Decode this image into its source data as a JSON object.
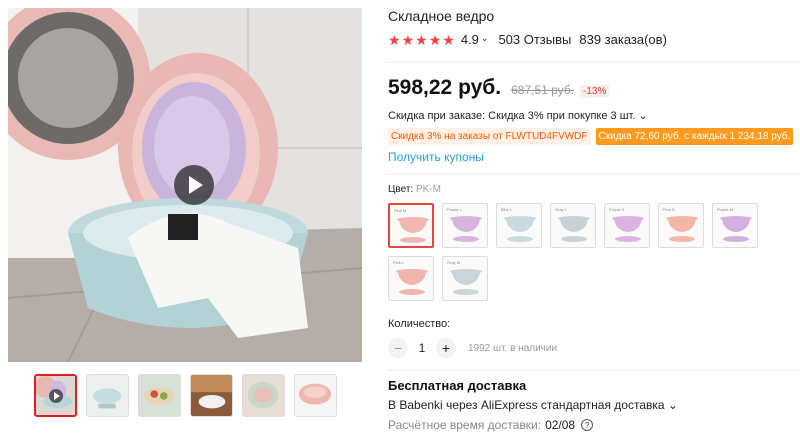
{
  "product": {
    "title": "Складное ведро",
    "rating": "4.9",
    "reviews": "503 Отзывы",
    "orders": "839 заказа(ов)"
  },
  "price": {
    "current": "598,22 руб.",
    "old": "687,51 руб.",
    "discount": "-13%"
  },
  "promo": {
    "order_discount": "Скидка при заказе: Скидка 3% при покупке 3 шт.",
    "coupon1": "Скидка 3% на заказы от FLWTUD4FVWDF",
    "coupon2": "Скидка 72,60 руб. с каждых 1 234,18 руб.",
    "get_coupons": "Получить купоны"
  },
  "color": {
    "label": "Цвет:",
    "selected": "PK-M",
    "swatches": [
      {
        "tag": "Pink M",
        "color": "#f0b8b0"
      },
      {
        "tag": "Purple L",
        "color": "#d8b6e0"
      },
      {
        "tag": "Blue L",
        "color": "#c9dbe0"
      },
      {
        "tag": "Gray L",
        "color": "#c8d3d6"
      },
      {
        "tag": "Purple S",
        "color": "#dcb4e4"
      },
      {
        "tag": "Pink S",
        "color": "#f3b7a8"
      },
      {
        "tag": "Purple M",
        "color": "#d4b0e0"
      },
      {
        "tag": "Pink L",
        "color": "#f0b5ac"
      },
      {
        "tag": "Gray M",
        "color": "#c9d5d8"
      }
    ]
  },
  "quantity": {
    "label": "Количество:",
    "value": "1",
    "stock": "1992 шт. в наличии",
    "minus": "−",
    "plus": "+"
  },
  "shipping": {
    "title": "Бесплатная доставка",
    "line": "В Babenki через AliExpress стандартная доставка",
    "time_label": "Расчётное время доставки:",
    "time_value": "02/08"
  },
  "icons": {
    "star": "star-icon",
    "play": "play-icon",
    "chevron": "chevron-down-icon",
    "help": "help-icon"
  },
  "colors": {
    "accent": "#ff3f3f",
    "link": "#2e9cd6",
    "coupon_orange": "#ff9a1f"
  }
}
